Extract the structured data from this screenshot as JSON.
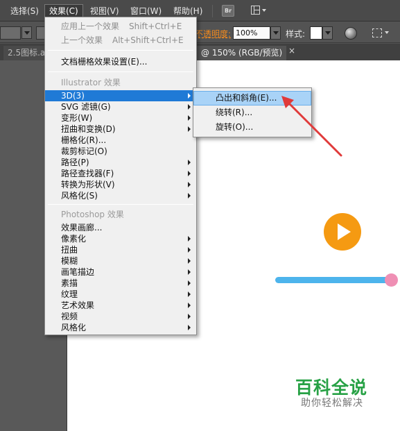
{
  "menubar": {
    "items": [
      {
        "label": "选择(S)"
      },
      {
        "label": "效果(C)"
      },
      {
        "label": "视图(V)"
      },
      {
        "label": "窗口(W)"
      },
      {
        "label": "帮助(H)"
      }
    ],
    "bridge_icon": "Br"
  },
  "controlbar": {
    "opacity_label": "不透明度:",
    "opacity_value": "100%",
    "style_label": "样式:"
  },
  "tabs": {
    "inactive_label": "2.5图标.a",
    "active_label": "@ 150% (RGB/预览)",
    "close_glyph": "×"
  },
  "effect_menu": {
    "items": [
      {
        "label": "应用上一个效果",
        "shortcut": "Shift+Ctrl+E"
      },
      {
        "label": "上一个效果",
        "shortcut": "Alt+Shift+Ctrl+E"
      },
      {
        "label": "文档栅格效果设置(E)..."
      },
      {
        "label": "Illustrator 效果"
      },
      {
        "label": "3D(3)"
      },
      {
        "label": "SVG 滤镜(G)"
      },
      {
        "label": "变形(W)"
      },
      {
        "label": "扭曲和变换(D)"
      },
      {
        "label": "栅格化(R)..."
      },
      {
        "label": "裁剪标记(O)"
      },
      {
        "label": "路径(P)"
      },
      {
        "label": "路径查找器(F)"
      },
      {
        "label": "转换为形状(V)"
      },
      {
        "label": "风格化(S)"
      },
      {
        "label": "Photoshop 效果"
      },
      {
        "label": "效果画廊..."
      },
      {
        "label": "像素化"
      },
      {
        "label": "扭曲"
      },
      {
        "label": "模糊"
      },
      {
        "label": "画笔描边"
      },
      {
        "label": "素描"
      },
      {
        "label": "纹理"
      },
      {
        "label": "艺术效果"
      },
      {
        "label": "视频"
      },
      {
        "label": "风格化"
      }
    ]
  },
  "submenu_3d": {
    "items": [
      {
        "label": "凸出和斜角(E)..."
      },
      {
        "label": "绕转(R)..."
      },
      {
        "label": "旋转(O)..."
      }
    ]
  },
  "watermark": {
    "title": "百科全说",
    "subtitle": "助你轻松解决"
  },
  "colors": {
    "menu_highlight": "#1f7ad6",
    "submenu_highlight": "#a9d3f7",
    "play_button": "#f59a12",
    "slider_track": "#4db4ec",
    "slider_knob": "#ef8fb4",
    "annotation_arrow": "#e03a3a",
    "watermark_green": "#27a145"
  },
  "icons": [
    "bridge-icon",
    "workspace-layout-icon",
    "globe-icon",
    "align-icon",
    "play-icon",
    "submenu-arrow-icon",
    "close-icon"
  ]
}
